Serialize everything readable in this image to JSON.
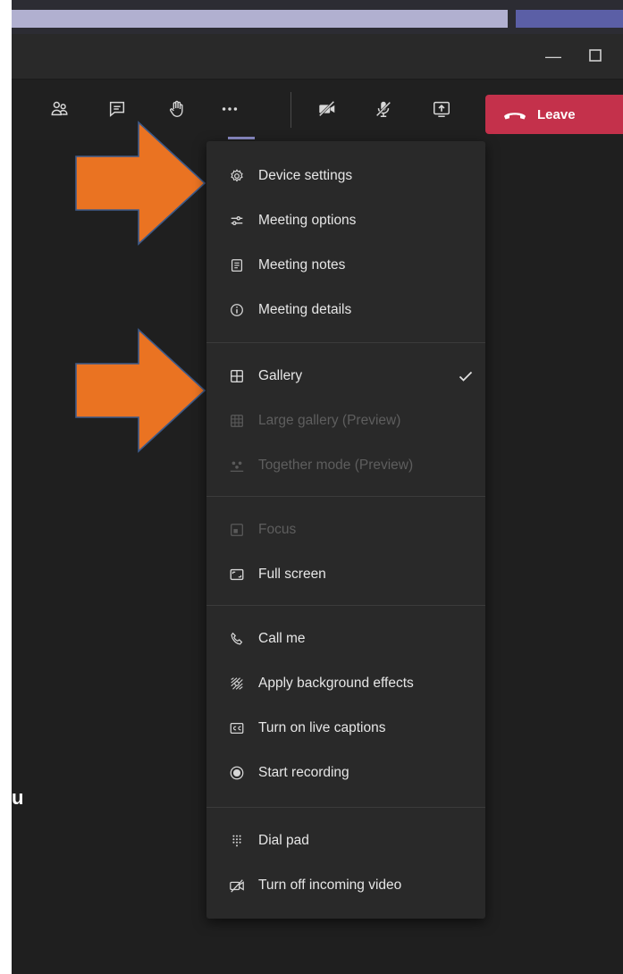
{
  "toolbar": {
    "leave_label": "Leave"
  },
  "menu": {
    "items": [
      {
        "label": "Device settings",
        "icon": "gear-icon"
      },
      {
        "label": "Meeting options",
        "icon": "sliders-icon"
      },
      {
        "label": "Meeting notes",
        "icon": "notes-icon"
      },
      {
        "label": "Meeting details",
        "icon": "info-icon"
      },
      {
        "label": "Gallery",
        "icon": "gallery-icon",
        "checked": true
      },
      {
        "label": "Large gallery (Preview)",
        "icon": "large-gallery-icon",
        "disabled": true
      },
      {
        "label": "Together mode (Preview)",
        "icon": "together-mode-icon",
        "disabled": true
      },
      {
        "label": "Focus",
        "icon": "focus-icon",
        "disabled": true
      },
      {
        "label": "Full screen",
        "icon": "full-screen-icon"
      },
      {
        "label": "Call me",
        "icon": "phone-icon"
      },
      {
        "label": "Apply background effects",
        "icon": "background-effects-icon"
      },
      {
        "label": "Turn on live captions",
        "icon": "captions-icon"
      },
      {
        "label": "Start recording",
        "icon": "record-icon"
      },
      {
        "label": "Dial pad",
        "icon": "dialpad-icon"
      },
      {
        "label": "Turn off incoming video",
        "icon": "video-off-icon"
      }
    ]
  },
  "side_text": "u",
  "colors": {
    "accent": "#8b8cc7",
    "leave": "#c4314b",
    "arrow": "#ea7322"
  }
}
